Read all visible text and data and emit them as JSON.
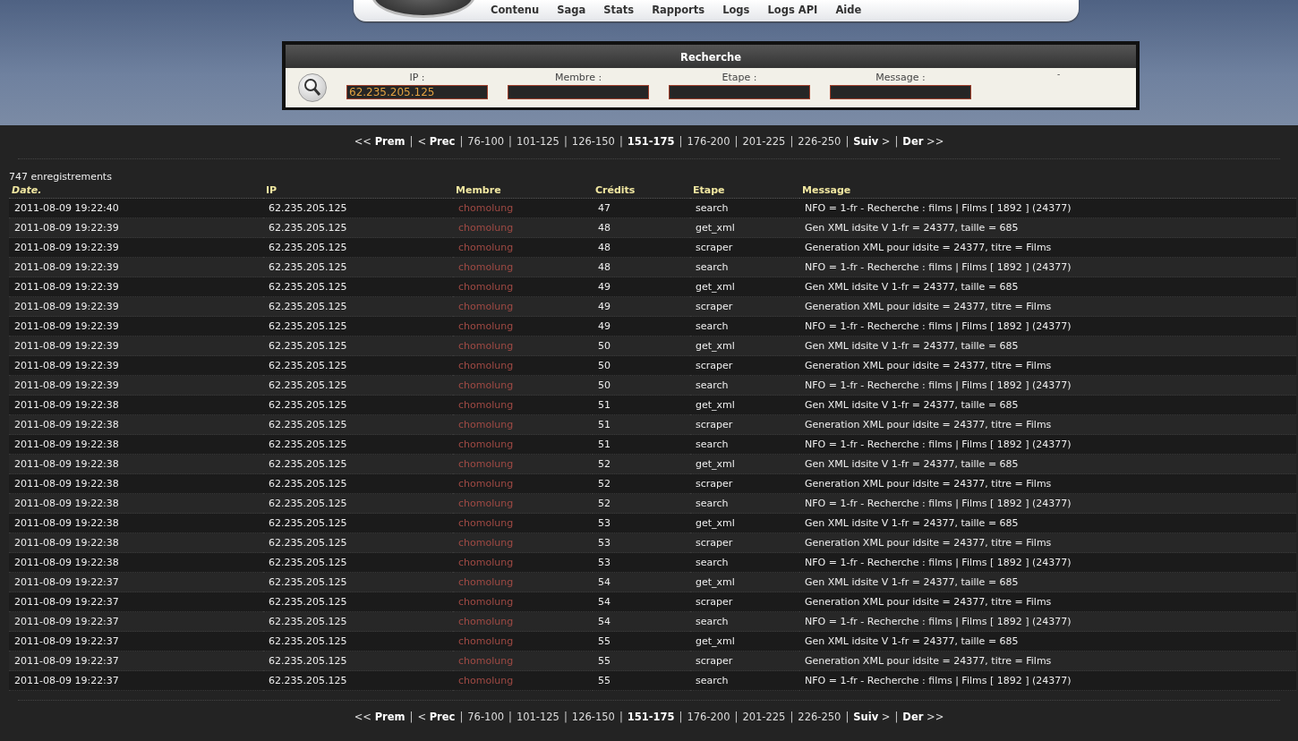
{
  "nav": [
    "Contenu",
    "Saga",
    "Stats",
    "Rapports",
    "Logs",
    "Logs API",
    "Aide"
  ],
  "search": {
    "title": "Recherche",
    "fields": [
      {
        "label": "IP :",
        "value": "62.235.205.125"
      },
      {
        "label": "Membre :"
      },
      {
        "label": "Etape :"
      },
      {
        "label": "Message :"
      }
    ],
    "mark": "-"
  },
  "pager_top": [
    {
      "kind": "nav",
      "label": "<< **Prem**"
    },
    {
      "kind": "sep",
      "label": "|"
    },
    {
      "kind": "nav",
      "label": "< **Prec**"
    },
    {
      "kind": "sep",
      "label": "|"
    },
    {
      "kind": "page",
      "label": "76-100",
      "selected": false
    },
    {
      "kind": "sep",
      "label": "|"
    },
    {
      "kind": "page",
      "label": "101-125",
      "selected": false
    },
    {
      "kind": "sep",
      "label": "|"
    },
    {
      "kind": "page",
      "label": "126-150",
      "selected": false
    },
    {
      "kind": "sep",
      "label": "|"
    },
    {
      "kind": "page",
      "label": "151-175",
      "selected": true
    },
    {
      "kind": "sep",
      "label": "|"
    },
    {
      "kind": "page",
      "label": "176-200",
      "selected": false
    },
    {
      "kind": "sep",
      "label": "|"
    },
    {
      "kind": "page",
      "label": "201-225",
      "selected": false
    },
    {
      "kind": "sep",
      "label": "|"
    },
    {
      "kind": "page",
      "label": "226-250",
      "selected": false
    },
    {
      "kind": "sep",
      "label": "|"
    },
    {
      "kind": "nav",
      "label": "**Suiv** >"
    },
    {
      "kind": "sep",
      "label": "|"
    },
    {
      "kind": "nav",
      "label": "**Der** >>"
    }
  ],
  "count": "747 enregistrements",
  "table": {
    "columns": [
      "Date.",
      "IP",
      "Membre",
      "Crédits",
      "Etape",
      "Message"
    ],
    "rows": [
      [
        "2011-08-09 19:22:40",
        "62.235.205.125",
        "chomolung",
        "47",
        "search",
        "NFO = 1-fr - Recherche : films | Films [ 1892 ] (24377)"
      ],
      [
        "2011-08-09 19:22:39",
        "62.235.205.125",
        "chomolung",
        "48",
        "get_xml",
        "Gen XML idsite V 1-fr = 24377, taille = 685"
      ],
      [
        "2011-08-09 19:22:39",
        "62.235.205.125",
        "chomolung",
        "48",
        "scraper",
        "Generation XML pour idsite = 24377, titre = Films"
      ],
      [
        "2011-08-09 19:22:39",
        "62.235.205.125",
        "chomolung",
        "48",
        "search",
        "NFO = 1-fr - Recherche : films | Films [ 1892 ] (24377)"
      ],
      [
        "2011-08-09 19:22:39",
        "62.235.205.125",
        "chomolung",
        "49",
        "get_xml",
        "Gen XML idsite V 1-fr = 24377, taille = 685"
      ],
      [
        "2011-08-09 19:22:39",
        "62.235.205.125",
        "chomolung",
        "49",
        "scraper",
        "Generation XML pour idsite = 24377, titre = Films"
      ],
      [
        "2011-08-09 19:22:39",
        "62.235.205.125",
        "chomolung",
        "49",
        "search",
        "NFO = 1-fr - Recherche : films | Films [ 1892 ] (24377)"
      ],
      [
        "2011-08-09 19:22:39",
        "62.235.205.125",
        "chomolung",
        "50",
        "get_xml",
        "Gen XML idsite V 1-fr = 24377, taille = 685"
      ],
      [
        "2011-08-09 19:22:39",
        "62.235.205.125",
        "chomolung",
        "50",
        "scraper",
        "Generation XML pour idsite = 24377, titre = Films"
      ],
      [
        "2011-08-09 19:22:39",
        "62.235.205.125",
        "chomolung",
        "50",
        "search",
        "NFO = 1-fr - Recherche : films | Films [ 1892 ] (24377)"
      ],
      [
        "2011-08-09 19:22:38",
        "62.235.205.125",
        "chomolung",
        "51",
        "get_xml",
        "Gen XML idsite V 1-fr = 24377, taille = 685"
      ],
      [
        "2011-08-09 19:22:38",
        "62.235.205.125",
        "chomolung",
        "51",
        "scraper",
        "Generation XML pour idsite = 24377, titre = Films"
      ],
      [
        "2011-08-09 19:22:38",
        "62.235.205.125",
        "chomolung",
        "51",
        "search",
        "NFO = 1-fr - Recherche : films | Films [ 1892 ] (24377)"
      ],
      [
        "2011-08-09 19:22:38",
        "62.235.205.125",
        "chomolung",
        "52",
        "get_xml",
        "Gen XML idsite V 1-fr = 24377, taille = 685"
      ],
      [
        "2011-08-09 19:22:38",
        "62.235.205.125",
        "chomolung",
        "52",
        "scraper",
        "Generation XML pour idsite = 24377, titre = Films"
      ],
      [
        "2011-08-09 19:22:38",
        "62.235.205.125",
        "chomolung",
        "52",
        "search",
        "NFO = 1-fr - Recherche : films | Films [ 1892 ] (24377)"
      ],
      [
        "2011-08-09 19:22:38",
        "62.235.205.125",
        "chomolung",
        "53",
        "get_xml",
        "Gen XML idsite V 1-fr = 24377, taille = 685"
      ],
      [
        "2011-08-09 19:22:38",
        "62.235.205.125",
        "chomolung",
        "53",
        "scraper",
        "Generation XML pour idsite = 24377, titre = Films"
      ],
      [
        "2011-08-09 19:22:38",
        "62.235.205.125",
        "chomolung",
        "53",
        "search",
        "NFO = 1-fr - Recherche : films | Films [ 1892 ] (24377)"
      ],
      [
        "2011-08-09 19:22:37",
        "62.235.205.125",
        "chomolung",
        "54",
        "get_xml",
        "Gen XML idsite V 1-fr = 24377, taille = 685"
      ],
      [
        "2011-08-09 19:22:37",
        "62.235.205.125",
        "chomolung",
        "54",
        "scraper",
        "Generation XML pour idsite = 24377, titre = Films"
      ],
      [
        "2011-08-09 19:22:37",
        "62.235.205.125",
        "chomolung",
        "54",
        "search",
        "NFO = 1-fr - Recherche : films | Films [ 1892 ] (24377)"
      ],
      [
        "2011-08-09 19:22:37",
        "62.235.205.125",
        "chomolung",
        "55",
        "get_xml",
        "Gen XML idsite V 1-fr = 24377, taille = 685"
      ],
      [
        "2011-08-09 19:22:37",
        "62.235.205.125",
        "chomolung",
        "55",
        "scraper",
        "Generation XML pour idsite = 24377, titre = Films"
      ],
      [
        "2011-08-09 19:22:37",
        "62.235.205.125",
        "chomolung",
        "55",
        "search",
        "NFO = 1-fr - Recherche : films | Films [ 1892 ] (24377)"
      ]
    ]
  },
  "pager_bottom": [
    {
      "kind": "nav",
      "label": "<< **Prem**"
    },
    {
      "kind": "sep",
      "label": "|"
    },
    {
      "kind": "nav",
      "label": "< **Prec**"
    },
    {
      "kind": "sep",
      "label": "|"
    },
    {
      "kind": "page",
      "label": "76-100",
      "selected": false
    },
    {
      "kind": "sep",
      "label": "|"
    },
    {
      "kind": "page",
      "label": "101-125",
      "selected": false
    },
    {
      "kind": "sep",
      "label": "|"
    },
    {
      "kind": "page",
      "label": "126-150",
      "selected": false
    },
    {
      "kind": "sep",
      "label": "|"
    },
    {
      "kind": "page",
      "label": "151-175",
      "selected": true
    },
    {
      "kind": "sep",
      "label": "|"
    },
    {
      "kind": "page",
      "label": "176-200",
      "selected": false
    },
    {
      "kind": "sep",
      "label": "|"
    },
    {
      "kind": "page",
      "label": "201-225",
      "selected": false
    },
    {
      "kind": "sep",
      "label": "|"
    },
    {
      "kind": "page",
      "label": "226-250",
      "selected": false
    },
    {
      "kind": "sep",
      "label": "|"
    },
    {
      "kind": "nav",
      "label": "**Suiv** >"
    },
    {
      "kind": "sep",
      "label": "|"
    },
    {
      "kind": "nav",
      "label": "**Der** >>"
    }
  ]
}
